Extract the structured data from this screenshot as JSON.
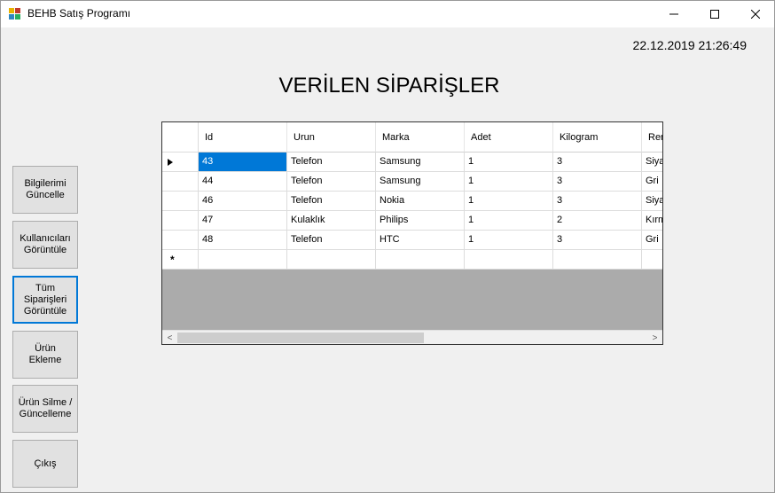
{
  "window": {
    "title": "BEHB Satış Programı",
    "minimize_icon": "minimize-icon",
    "maximize_icon": "maximize-icon",
    "close_icon": "close-icon"
  },
  "datetime": "22.12.2019 21:26:49",
  "heading": "VERİLEN SİPARİŞLER",
  "sidebar": {
    "buttons": [
      {
        "label": "Bilgilerimi\nGüncelle"
      },
      {
        "label": "Kullanıcıları\nGörüntüle"
      },
      {
        "label": "Tüm\nSiparişleri\nGörüntüle",
        "active": true
      },
      {
        "label": "Ürün\nEkleme"
      },
      {
        "label": "Ürün Silme /\nGüncelleme"
      },
      {
        "label": "Çıkış"
      }
    ]
  },
  "grid": {
    "columns": [
      "Id",
      "Urun",
      "Marka",
      "Adet",
      "Kilogram",
      "Ren"
    ],
    "rows": [
      [
        "43",
        "Telefon",
        "Samsung",
        "1",
        "3",
        "Siya"
      ],
      [
        "44",
        "Telefon",
        "Samsung",
        "1",
        "3",
        "Gri"
      ],
      [
        "46",
        "Telefon",
        "Nokia",
        "1",
        "3",
        "Siya"
      ],
      [
        "47",
        "Kulaklık",
        "Philips",
        "1",
        "2",
        "Kırm"
      ],
      [
        "48",
        "Telefon",
        "HTC",
        "1",
        "3",
        "Gri"
      ]
    ],
    "current_row_marker": "▶",
    "new_row_marker": "*",
    "scroll_left": "<",
    "scroll_right": ">"
  },
  "colors": {
    "selection": "#0078d7",
    "empty_area": "#ababab"
  }
}
